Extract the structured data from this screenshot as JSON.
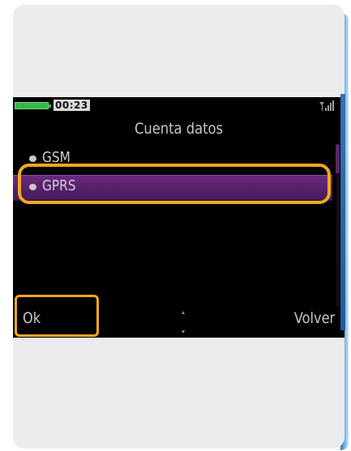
{
  "status_bar": {
    "time": "00:23",
    "battery_icon": "battery-full-icon",
    "signal_icon": "signal-strength-icon"
  },
  "screen": {
    "title": "Cuenta datos"
  },
  "list": {
    "items": [
      {
        "label": "GSM",
        "selected": false
      },
      {
        "label": "GPRS",
        "selected": true
      }
    ]
  },
  "softkeys": {
    "left": "Ok",
    "right": "Volver"
  },
  "colors": {
    "highlight_outline": "#f2a81e",
    "selection_bar": "#55206a",
    "battery": "#36b84a",
    "screen_background": "#000000",
    "card_background": "#ebeced"
  }
}
